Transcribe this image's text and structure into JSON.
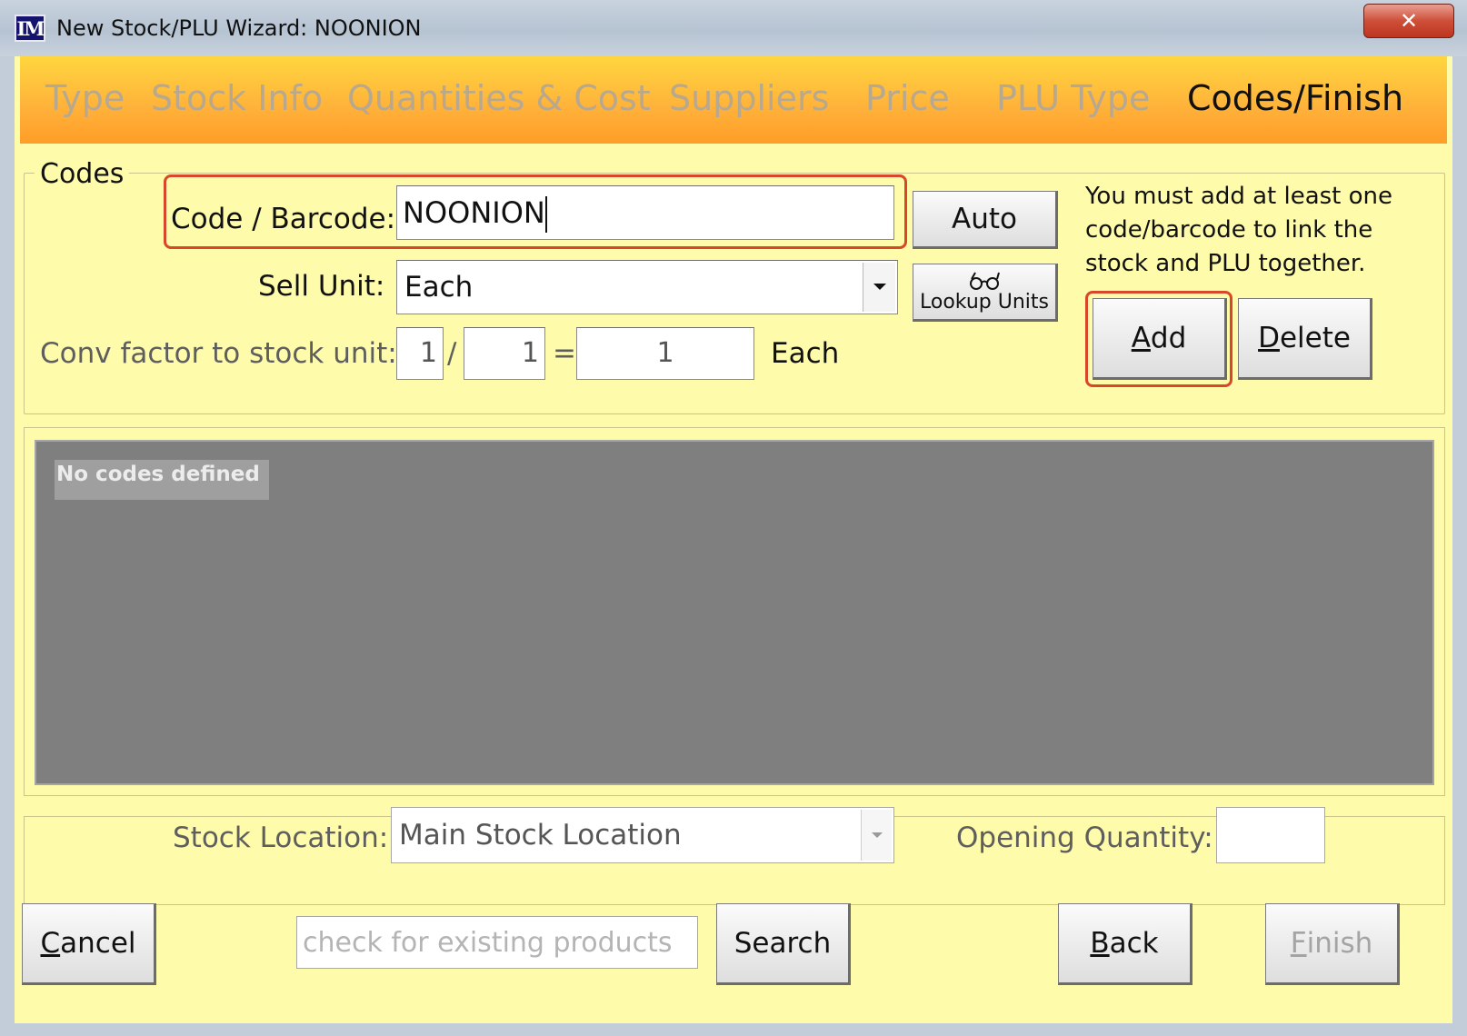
{
  "window": {
    "logo": "IM",
    "title": "New Stock/PLU Wizard: NOONION",
    "close_glyph": "✕"
  },
  "steps": [
    {
      "label": "Type",
      "active": false
    },
    {
      "label": "Stock Info",
      "active": false
    },
    {
      "label": "Quantities & Cost",
      "active": false
    },
    {
      "label": "Suppliers",
      "active": false
    },
    {
      "label": "Price",
      "active": false
    },
    {
      "label": "PLU Type",
      "active": false
    },
    {
      "label": "Codes/Finish",
      "active": true
    }
  ],
  "codes": {
    "legend": "Codes",
    "barcode_label": "Code / Barcode:",
    "barcode_value": "NOONION",
    "auto_label": "Auto",
    "sell_unit_label": "Sell Unit:",
    "sell_unit_value": "Each",
    "lookup_units_label": "Lookup Units",
    "conv_label": "Conv factor to stock unit:",
    "conv_numerator": "1",
    "conv_slash": "/",
    "conv_denominator": "1",
    "conv_equals": "=",
    "conv_result": "1",
    "conv_unit": "Each",
    "hint_lines": [
      "You must add at least one",
      "code/barcode to link the",
      "stock and PLU together."
    ],
    "add": {
      "first": "A",
      "rest": "dd"
    },
    "delete": {
      "first": "D",
      "rest": "elete"
    }
  },
  "list": {
    "empty_text": "No codes defined"
  },
  "location": {
    "label": "Stock Location:",
    "value": "Main Stock Location",
    "opening_label": "Opening Quantity:",
    "opening_value": ""
  },
  "footer": {
    "cancel": {
      "first": "C",
      "rest": "ancel"
    },
    "search_placeholder": "check for existing products",
    "search_label": "Search",
    "back": {
      "first": "B",
      "rest": "ack"
    },
    "finish": {
      "first": "F",
      "rest": "inish"
    }
  },
  "colors": {
    "panel_bg": "#fefbaa",
    "header_gradient_top": "#ffd63f",
    "header_gradient_bottom": "#ff9d27",
    "highlight": "#d9472b",
    "list_bg": "#7f7f7f",
    "inactive_step": "#b8a88d"
  }
}
